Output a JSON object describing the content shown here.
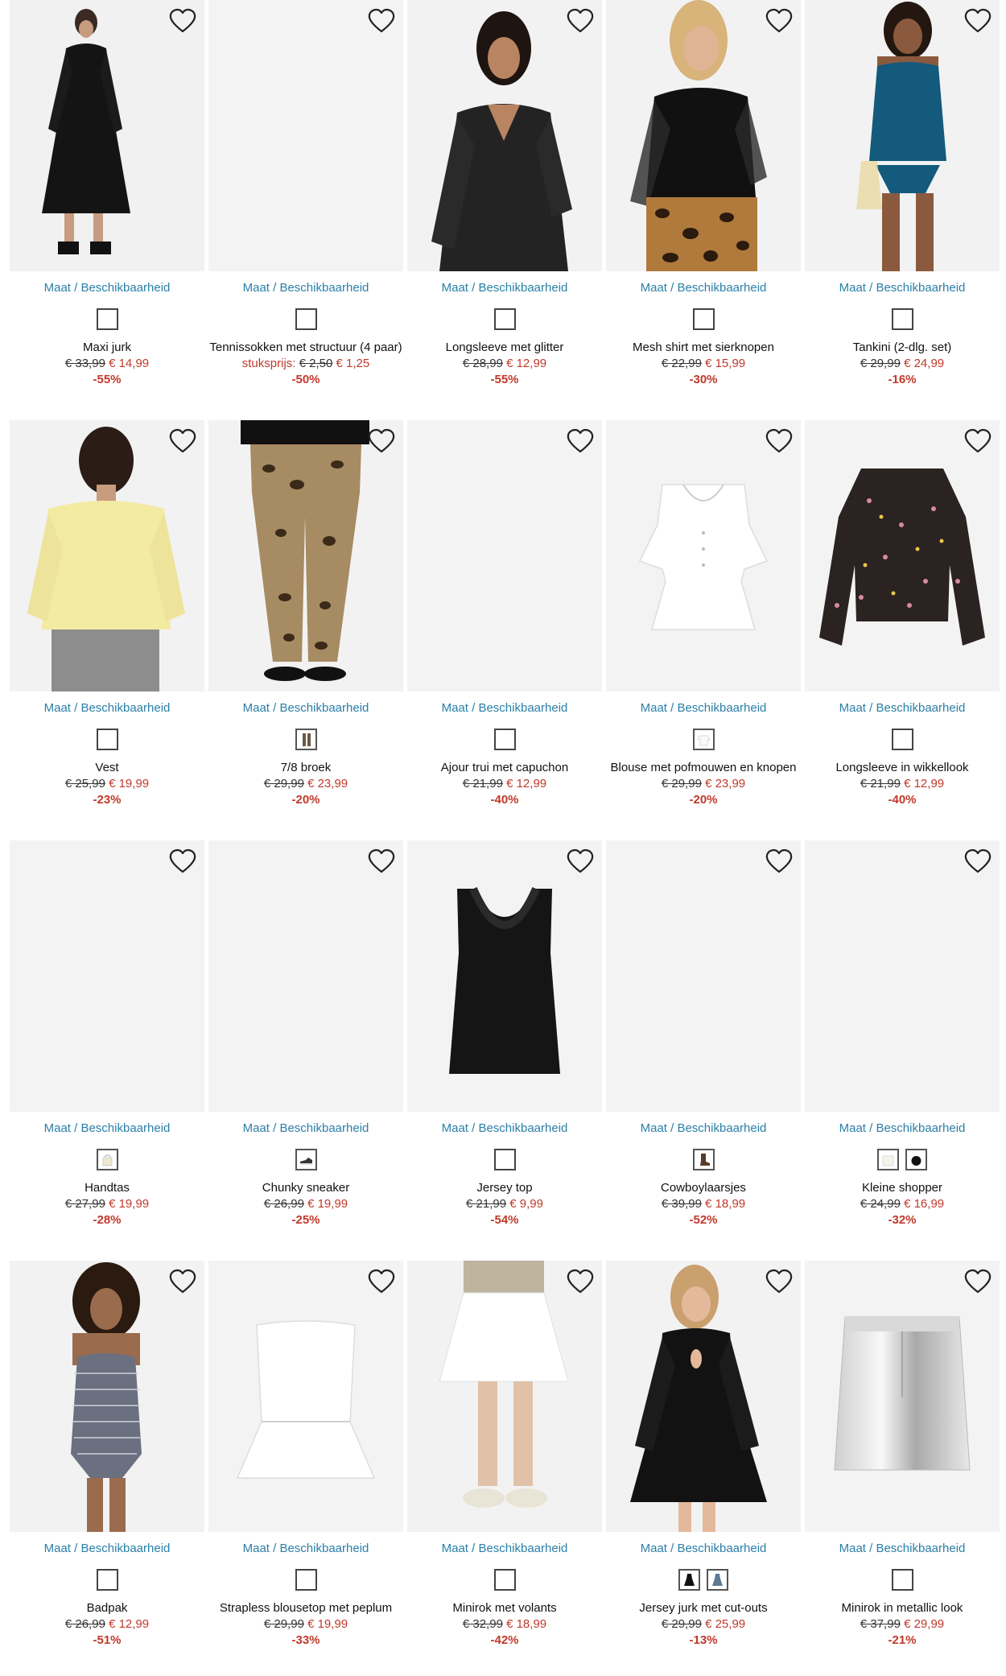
{
  "common": {
    "maat_label": "Maat / Beschikbaarheid",
    "heart_icon": "heart-outline-icon"
  },
  "colors": {
    "link": "#2a7fa8",
    "sale": "#c0392b",
    "image_bg": "#f3f3f3"
  },
  "products": [
    {
      "name": "Maxi jurk",
      "old": "€ 33,99",
      "new": "€ 14,99",
      "discount": "-55%",
      "swatches": [
        "plain"
      ],
      "art": "maxi-dress"
    },
    {
      "name": "Tennissokken met structuur (4 paar)",
      "unit_label": "stuksprijs:",
      "old": "€ 2,50",
      "new": "€ 1,25",
      "discount": "-50%",
      "swatches": [
        "plain"
      ],
      "art": "blank"
    },
    {
      "name": "Longsleeve met glitter",
      "old": "€ 28,99",
      "new": "€ 12,99",
      "discount": "-55%",
      "swatches": [
        "plain"
      ],
      "art": "glitter-top"
    },
    {
      "name": "Mesh shirt met sierknopen",
      "old": "€ 22,99",
      "new": "€ 15,99",
      "discount": "-30%",
      "swatches": [
        "plain"
      ],
      "art": "mesh-shirt"
    },
    {
      "name": "Tankini (2-dlg. set)",
      "old": "€ 29,99",
      "new": "€ 24,99",
      "discount": "-16%",
      "swatches": [
        "plain"
      ],
      "art": "tankini"
    },
    {
      "name": "Vest",
      "old": "€ 25,99",
      "new": "€ 19,99",
      "discount": "-23%",
      "swatches": [
        "plain"
      ],
      "art": "vest"
    },
    {
      "name": "7/8 broek",
      "old": "€ 29,99",
      "new": "€ 23,99",
      "discount": "-20%",
      "swatches": [
        "trousers"
      ],
      "art": "leopard-pants"
    },
    {
      "name": "Ajour trui met capuchon",
      "old": "€ 21,99",
      "new": "€ 12,99",
      "discount": "-40%",
      "swatches": [
        "plain"
      ],
      "art": "blank"
    },
    {
      "name": "Blouse met pofmouwen en knopen",
      "old": "€ 29,99",
      "new": "€ 23,99",
      "discount": "-20%",
      "swatches": [
        "white-top"
      ],
      "art": "white-blouse"
    },
    {
      "name": "Longsleeve in wikkellook",
      "old": "€ 21,99",
      "new": "€ 12,99",
      "discount": "-40%",
      "swatches": [
        "plain"
      ],
      "art": "floral-blouse"
    },
    {
      "name": "Handtas",
      "old": "€ 27,99",
      "new": "€ 19,99",
      "discount": "-28%",
      "swatches": [
        "bag"
      ],
      "art": "blank"
    },
    {
      "name": "Chunky sneaker",
      "old": "€ 26,99",
      "new": "€ 19,99",
      "discount": "-25%",
      "swatches": [
        "sneaker"
      ],
      "art": "blank"
    },
    {
      "name": "Jersey top",
      "old": "€ 21,99",
      "new": "€ 9,99",
      "discount": "-54%",
      "swatches": [
        "plain"
      ],
      "art": "black-top"
    },
    {
      "name": "Cowboylaarsjes",
      "old": "€ 39,99",
      "new": "€ 18,99",
      "discount": "-52%",
      "swatches": [
        "boot"
      ],
      "art": "blank"
    },
    {
      "name": "Kleine shopper",
      "old": "€ 24,99",
      "new": "€ 16,99",
      "discount": "-32%",
      "swatches": [
        "cream-bag",
        "black-bag"
      ],
      "art": "blank"
    },
    {
      "name": "Badpak",
      "old": "€ 26,99",
      "new": "€ 12,99",
      "discount": "-51%",
      "swatches": [
        "plain"
      ],
      "art": "swimsuit"
    },
    {
      "name": "Strapless blousetop met peplum",
      "old": "€ 29,99",
      "new": "€ 19,99",
      "discount": "-33%",
      "swatches": [
        "plain"
      ],
      "art": "strapless"
    },
    {
      "name": "Minirok met volants",
      "old": "€ 32,99",
      "new": "€ 18,99",
      "discount": "-42%",
      "swatches": [
        "plain"
      ],
      "art": "white-skirt"
    },
    {
      "name": "Jersey jurk met cut-outs",
      "old": "€ 29,99",
      "new": "€ 25,99",
      "discount": "-13%",
      "swatches": [
        "black-dress",
        "blue-dress"
      ],
      "art": "cutout-dress"
    },
    {
      "name": "Minirok in metallic look",
      "old": "€ 37,99",
      "new": "€ 29,99",
      "discount": "-21%",
      "swatches": [
        "plain"
      ],
      "art": "metallic-skirt"
    }
  ]
}
